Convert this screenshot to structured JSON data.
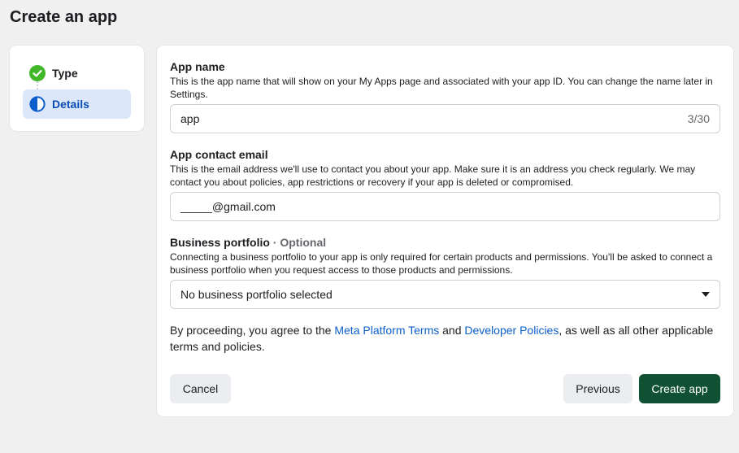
{
  "page": {
    "title": "Create an app"
  },
  "stepper": {
    "steps": [
      {
        "label": "Type",
        "state": "complete",
        "icon": "check-circle-icon"
      },
      {
        "label": "Details",
        "state": "in-progress",
        "icon": "half-circle-icon"
      }
    ]
  },
  "form": {
    "app_name": {
      "title": "App name",
      "description": "This is the app name that will show on your My Apps page and associated with your app ID. You can change the name later in Settings.",
      "value": "app",
      "counter": "3/30"
    },
    "contact_email": {
      "title": "App contact email",
      "description": "This is the email address we'll use to contact you about your app. Make sure it is an address you check regularly. We may contact you about policies, app restrictions or recovery if your app is deleted or compromised.",
      "value": "_____@gmail.com"
    },
    "business_portfolio": {
      "title": "Business portfolio",
      "optional": " · Optional",
      "description": "Connecting a business portfolio to your app is only required for certain products and permissions. You'll be asked to connect a business portfolio when you request access to those products and permissions.",
      "selected": "No business portfolio selected"
    },
    "terms": {
      "prefix": "By proceeding, you agree to the ",
      "link1": "Meta Platform Terms",
      "middle": " and ",
      "link2": "Developer Policies",
      "suffix": ", as well as all other applicable terms and policies."
    }
  },
  "actions": {
    "cancel": "Cancel",
    "previous": "Previous",
    "create": "Create app"
  },
  "colors": {
    "accent_blue": "#0b5fcc",
    "step_active_bg": "#dce8fa",
    "success_green": "#42b72a",
    "primary_button": "#0f5132"
  }
}
